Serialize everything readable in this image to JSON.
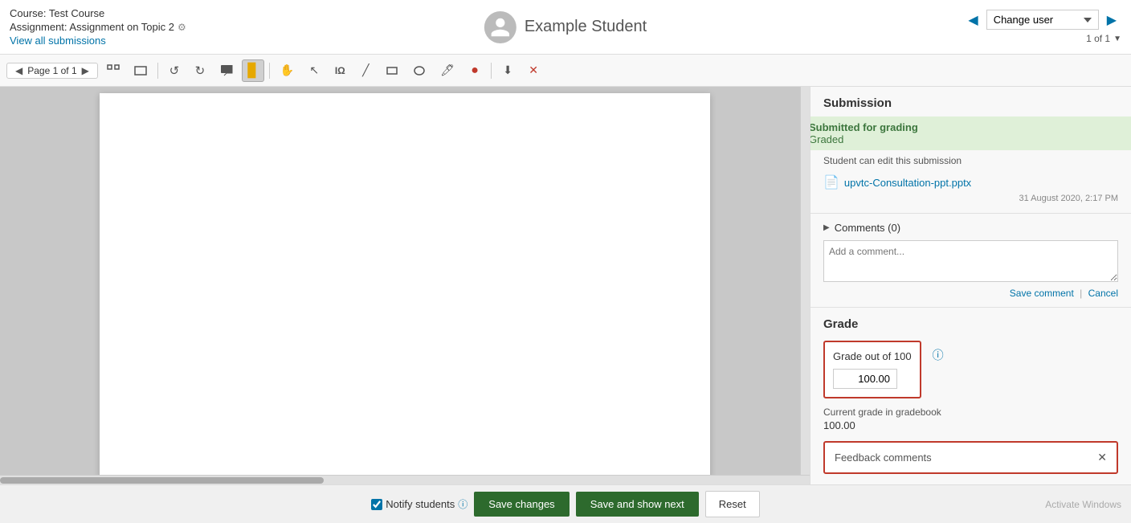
{
  "header": {
    "course_name": "Course: Test Course",
    "assignment_name": "Assignment: Assignment on Topic 2",
    "view_all": "View all submissions",
    "student_name": "Example Student",
    "change_user_label": "Change user",
    "pagination": "1 of 1"
  },
  "toolbar": {
    "page_nav": "Page 1 of 1"
  },
  "submission": {
    "section_title": "Submission",
    "status_submitted": "Submitted for grading",
    "status_graded": "Graded",
    "edit_notice": "Student can edit this submission",
    "file_name": "upvtc-Consultation-ppt.pptx",
    "file_date": "31 August 2020, 2:17 PM"
  },
  "comments": {
    "header": "Comments (0)",
    "placeholder": "Add a comment...",
    "save_label": "Save comment",
    "cancel_label": "Cancel"
  },
  "grade": {
    "section_title": "Grade",
    "grade_label": "Grade out of 100",
    "grade_value": "100.00",
    "current_grade_label": "Current grade in gradebook",
    "current_grade_value": "100.00"
  },
  "feedback": {
    "label": "Feedback comments"
  },
  "bottom_bar": {
    "notify_label": "Notify students",
    "save_changes": "Save changes",
    "save_and_show_next": "Save and show next",
    "reset": "Reset",
    "activate_windows": "Activate Windows"
  }
}
